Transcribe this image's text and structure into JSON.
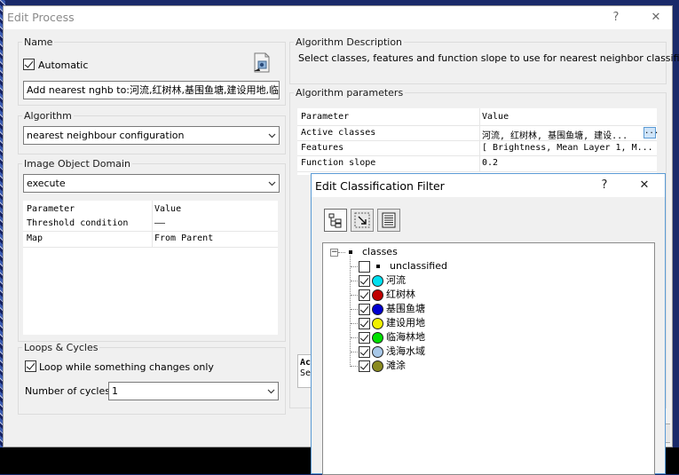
{
  "edit_process": {
    "title": "Edit Process",
    "help_label": "?",
    "close_label": "✕",
    "name_group": {
      "legend": "Name",
      "automatic_label": "Automatic",
      "automatic_checked": true,
      "name_value": "Add nearest nghb to:河流,红树林,基围鱼塘,建设用地,临"
    },
    "algorithm_group": {
      "legend": "Algorithm",
      "selected": "nearest neighbour configuration"
    },
    "domain_group": {
      "legend": "Image Object Domain",
      "selected": "execute",
      "table": {
        "headers": [
          "Parameter",
          "Value"
        ],
        "rows": [
          {
            "parameter": "Threshold condition",
            "value": "——"
          },
          {
            "parameter": "Map",
            "value": "From Parent"
          }
        ]
      }
    },
    "loops_group": {
      "legend": "Loops & Cycles",
      "loop_label": "Loop while something changes only",
      "loop_checked": true,
      "cycles_label": "Number of cycles",
      "cycles_value": "1"
    },
    "description_group": {
      "legend": "Algorithm Description",
      "text": "Select classes, features and function slope to use for nearest neighbor classification."
    },
    "params_group": {
      "legend": "Algorithm parameters",
      "headers": [
        "Parameter",
        "Value"
      ],
      "rows": [
        {
          "parameter": "Active classes",
          "value": "河流, 红树林, 基围鱼塘, 建设..."
        },
        {
          "parameter": "Features",
          "value": "[ Brightness, Mean Layer 1, M..."
        },
        {
          "parameter": "Function slope",
          "value": "0.2"
        }
      ],
      "browse_label": "...",
      "partial_bold": "Ac",
      "partial_text": "Se"
    }
  },
  "classification_filter": {
    "title": "Edit Classification Filter",
    "help_label": "?",
    "close_label": "✕",
    "toolbar": [
      "tree-view-icon",
      "select-arrow-icon",
      "list-view-icon"
    ],
    "root_label": "classes",
    "expand_glyph": "−",
    "items": [
      {
        "label": "unclassified",
        "checked": false,
        "color": null
      },
      {
        "label": "河流",
        "checked": true,
        "color": "#00e0f0"
      },
      {
        "label": "红树林",
        "checked": true,
        "color": "#c00000"
      },
      {
        "label": "基围鱼塘",
        "checked": true,
        "color": "#0000d0"
      },
      {
        "label": "建设用地",
        "checked": true,
        "color": "#f0f000"
      },
      {
        "label": "临海林地",
        "checked": true,
        "color": "#00e000"
      },
      {
        "label": "浅海水域",
        "checked": true,
        "color": "#a8c8e8"
      },
      {
        "label": "滩涂",
        "checked": true,
        "color": "#8a8a20"
      }
    ]
  }
}
